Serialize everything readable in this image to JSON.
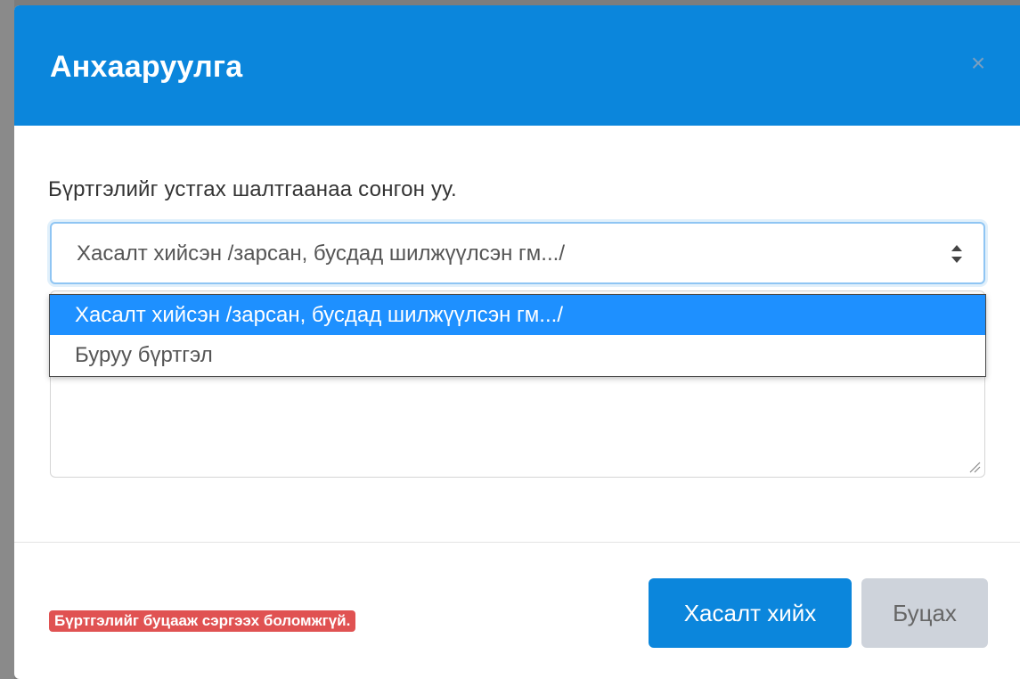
{
  "modal": {
    "title": "Анхааруулга",
    "close_symbol": "×"
  },
  "body": {
    "prompt": "Бүртгэлийг устгах шалтгаанаа сонгон уу.",
    "reason_select": {
      "selected": "Хасалт хийсэн /зарсан, бусдад шилжүүлсэн гм.../",
      "options": [
        "Хасалт хийсэн /зарсан, бусдад шилжүүлсэн гм.../",
        "Буруу бүртгэл"
      ]
    }
  },
  "footer": {
    "warning": "Бүртгэлийг буцааж сэргээх боломжгүй.",
    "confirm_label": "Хасалт хийх",
    "cancel_label": "Буцах"
  },
  "colors": {
    "header_bg": "#0b86dc",
    "primary_button": "#0b86dc",
    "secondary_button": "#ced3db",
    "warning_badge": "#e05252",
    "option_highlight": "#1e90ff"
  }
}
